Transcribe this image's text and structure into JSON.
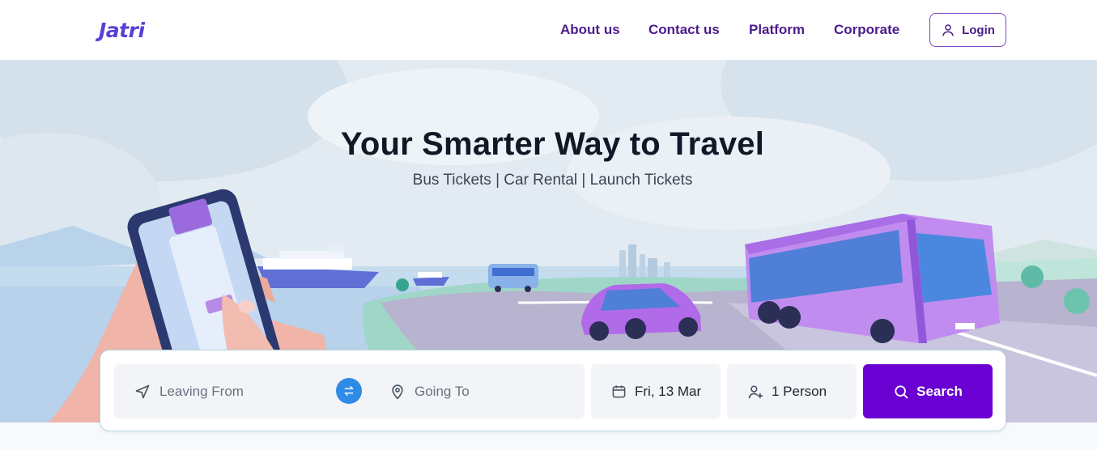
{
  "brand": {
    "name": "Jatri",
    "logo_text": "Jatri"
  },
  "nav": {
    "items": [
      {
        "label": "About us"
      },
      {
        "label": "Contact us"
      },
      {
        "label": "Platform"
      },
      {
        "label": "Corporate"
      }
    ],
    "login_label": "Login"
  },
  "hero": {
    "title": "Your Smarter Way to Travel",
    "subtitle": "Bus Tickets | Car Rental | Launch Tickets"
  },
  "search": {
    "from_placeholder": "Leaving From",
    "to_placeholder": "Going To",
    "date": "Fri, 13 Mar",
    "passengers": "1 Person",
    "button_label": "Search"
  },
  "colors": {
    "brand_purple": "#6a00d1",
    "nav_text": "#4b1b8c",
    "swap_blue": "#2f8be6"
  },
  "icons": [
    "user-icon",
    "navigation-arrow-icon",
    "swap-icon",
    "map-pin-icon",
    "calendar-icon",
    "user-plus-icon",
    "search-icon"
  ]
}
